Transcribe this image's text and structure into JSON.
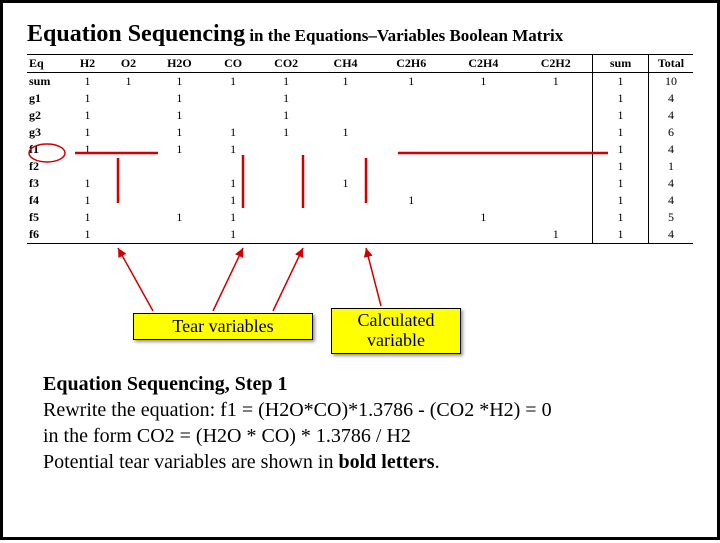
{
  "title_main": "Equation Sequencing",
  "title_sub": " in the Equations–Variables Boolean Matrix",
  "table": {
    "eq_header": "Eq",
    "sum_header": "sum",
    "total_header": "Total",
    "cols": [
      "H2",
      "O2",
      "H2O",
      "CO",
      "CO2",
      "CH4",
      "C2H6",
      "C2H4",
      "C2H2"
    ],
    "rows": [
      {
        "label": "sum",
        "v": [
          "1",
          "1",
          "1",
          "1",
          "1",
          "1",
          "1",
          "1",
          "1"
        ],
        "sum": "1",
        "total": "10"
      },
      {
        "label": "g1",
        "v": [
          "1",
          "",
          "1",
          "",
          "1",
          "",
          "",
          "",
          ""
        ],
        "sum": "1",
        "total": "4"
      },
      {
        "label": "g2",
        "v": [
          "1",
          "",
          "1",
          "",
          "1",
          "",
          "",
          "",
          ""
        ],
        "sum": "1",
        "total": "4"
      },
      {
        "label": "g3",
        "v": [
          "1",
          "",
          "1",
          "1",
          "1",
          "1",
          "",
          "",
          ""
        ],
        "sum": "1",
        "total": "6"
      },
      {
        "label": "f1",
        "v": [
          "1",
          "",
          "1",
          "1",
          "",
          "",
          "",
          "",
          ""
        ],
        "sum": "1",
        "total": "4"
      },
      {
        "label": "f2",
        "v": [
          "",
          "",
          "",
          "",
          "",
          "",
          "",
          "",
          ""
        ],
        "sum": "1",
        "total": "1"
      },
      {
        "label": "f3",
        "v": [
          "1",
          "",
          "",
          "1",
          "",
          "1",
          "",
          "",
          ""
        ],
        "sum": "1",
        "total": "4"
      },
      {
        "label": "f4",
        "v": [
          "1",
          "",
          "",
          "1",
          "",
          "",
          "1",
          "",
          ""
        ],
        "sum": "1",
        "total": "4"
      },
      {
        "label": "f5",
        "v": [
          "1",
          "",
          "1",
          "1",
          "",
          "",
          "",
          "1",
          ""
        ],
        "sum": "1",
        "total": "5"
      },
      {
        "label": "f6",
        "v": [
          "1",
          "",
          "",
          "1",
          "",
          "",
          "",
          "",
          "1"
        ],
        "sum": "1",
        "total": "4"
      }
    ]
  },
  "tear_label": "Tear variables",
  "calc_label": "Calculated variable",
  "step_title": "Equation Sequencing, Step 1",
  "line1": "Rewrite the equation: f1 = (H2O*CO)*1.3786 - (CO2 *H2) = 0",
  "line2": "in the form CO2 = (H2O * CO) * 1.3786 / H2",
  "line3a": "Potential tear variables are shown in ",
  "line3b": "bold letters",
  "line3c": "."
}
